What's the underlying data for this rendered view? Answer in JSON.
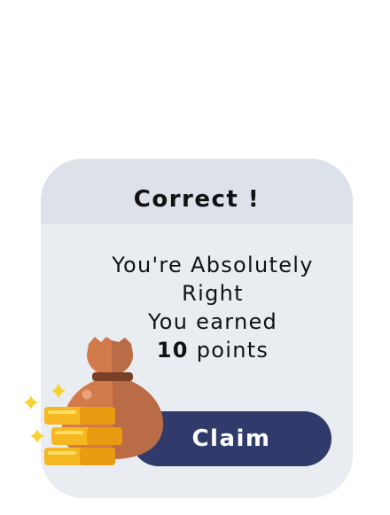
{
  "dialog": {
    "title": "Correct !",
    "message_line1": "You're Absolutely",
    "message_line2": "Right",
    "message_line3": "You earned",
    "points_value": "10",
    "points_label": "points",
    "claim_label": "Claim"
  },
  "colors": {
    "card_background": "#e9ecf1",
    "header_background": "#dde2ea",
    "button_background": "#313b6b",
    "button_text": "#ffffff",
    "text": "#121212",
    "coin_gold": "#f5b820",
    "bag_brown": "#b96c45"
  },
  "icons": {
    "reward": "money-bag-with-coin-stacks-icon",
    "sparkle": "sparkle-icon"
  }
}
